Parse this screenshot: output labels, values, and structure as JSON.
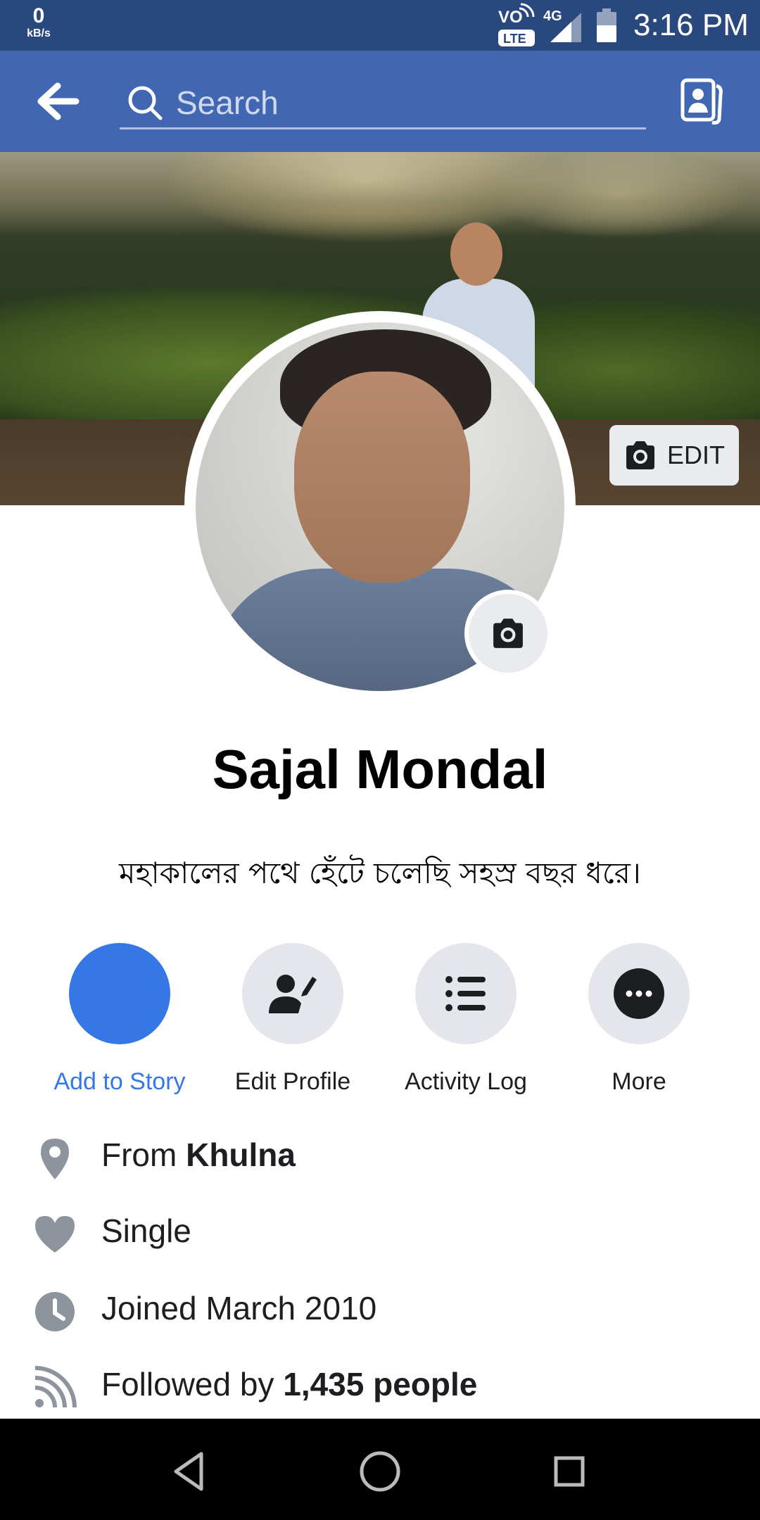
{
  "status_bar": {
    "speed_value": "0",
    "speed_unit": "kB/s",
    "volte_top": "VO",
    "volte_bottom": "LTE",
    "network": "4G",
    "time": "3:16 PM"
  },
  "header": {
    "search_placeholder": "Search",
    "back_icon": "back-arrow-icon",
    "contacts_icon": "contacts-icon"
  },
  "cover": {
    "edit_label": "EDIT"
  },
  "profile": {
    "name": "Sajal Mondal",
    "bio": "মহাকালের পথে হেঁটে চলেছি সহস্র বছর ধরে।"
  },
  "actions": [
    {
      "label": "Add to Story"
    },
    {
      "label": "Edit Profile"
    },
    {
      "label": "Activity Log"
    },
    {
      "label": "More"
    }
  ],
  "info": {
    "from_prefix": "From ",
    "from_value": "Khulna",
    "relationship": "Single",
    "joined": "Joined March 2010",
    "followed_prefix": "Followed by ",
    "followed_value": "1,435 people"
  },
  "colors": {
    "status_bar": "#29487d",
    "header": "#4267b2",
    "accent": "#3578e5",
    "icon_gray": "#8d949e"
  }
}
